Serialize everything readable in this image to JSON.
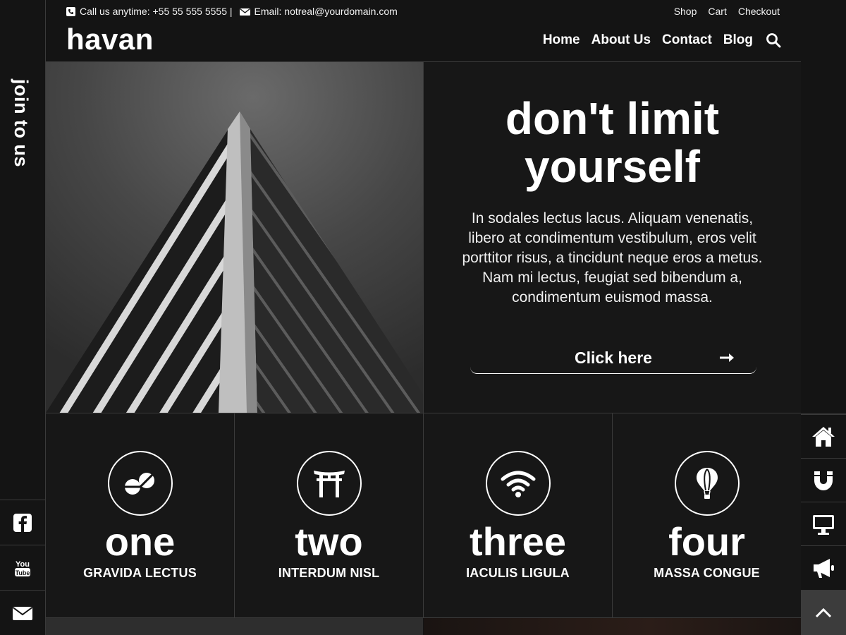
{
  "header": {
    "phone_text": "Call us anytime: +55 55 555 5555 |",
    "email_text": "Email: notreal@yourdomain.com",
    "top_links": [
      "Shop",
      "Cart",
      "Checkout"
    ],
    "logo": "havan",
    "nav": [
      "Home",
      "About Us",
      "Contact",
      "Blog"
    ]
  },
  "left_rail": {
    "label": "join to us",
    "social_icons": [
      "facebook-icon",
      "youtube-icon",
      "mail-icon"
    ]
  },
  "right_rail": {
    "icons": [
      "home-icon",
      "magnet-icon",
      "monitor-icon",
      "megaphone-icon",
      "chevron-up-icon"
    ]
  },
  "hero": {
    "title": "don't limit yourself",
    "body": "In sodales lectus lacus. Aliquam venenatis, libero at condimentum vestibulum, eros velit porttitor risus, a tincidunt neque eros a metus. Nam mi lectus, feugiat sed bibendum a, condimentum euismod massa.",
    "cta_label": "Click here"
  },
  "features": [
    {
      "icon": "pills-icon",
      "title": "one",
      "subtitle": "GRAVIDA LECTUS"
    },
    {
      "icon": "torii-gate-icon",
      "title": "two",
      "subtitle": "INTERDUM NISL"
    },
    {
      "icon": "wifi-icon",
      "title": "three",
      "subtitle": "IACULIS LIGULA"
    },
    {
      "icon": "hot-air-balloon-icon",
      "title": "four",
      "subtitle": "MASSA CONGUE"
    }
  ],
  "colors": {
    "background": "#141414",
    "panel": "#171717",
    "divider": "#3a3a3a",
    "text": "#ffffff"
  }
}
